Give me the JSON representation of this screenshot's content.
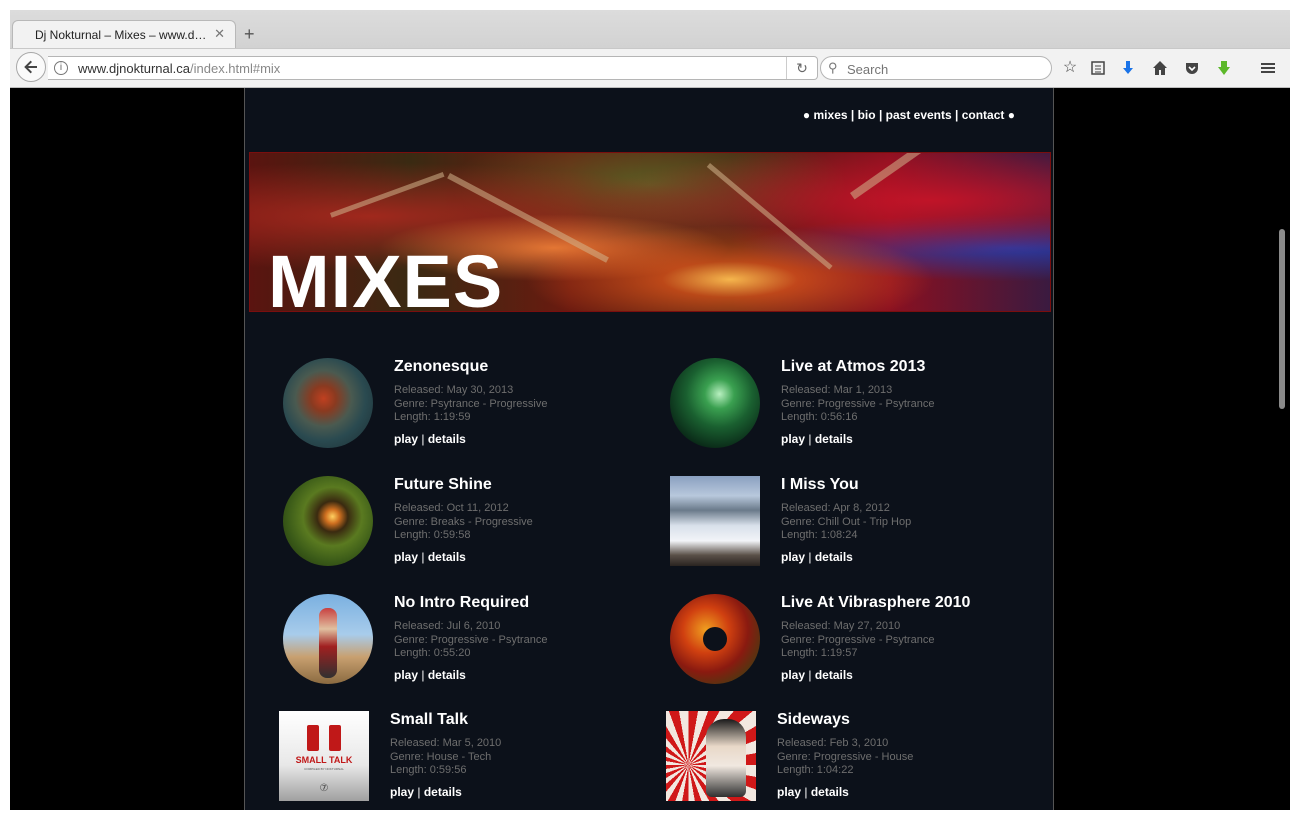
{
  "browser": {
    "tab_title": "Dj Nokturnal – Mixes – www.d…",
    "tab_close": "✕",
    "new_tab": "+",
    "url_domain": "www.djnokturnal.ca",
    "url_path": "/index.html#mix",
    "search_placeholder": "Search"
  },
  "nav": {
    "bullet": "●",
    "items": [
      "mixes",
      "bio",
      "past events",
      "contact"
    ],
    "separator": "|"
  },
  "banner": {
    "title": "MIXES"
  },
  "mix_links": {
    "play": "play",
    "details": "details",
    "separator": "|"
  },
  "mixes": [
    {
      "title": "Zenonesque",
      "released": "Released: May 30, 2013",
      "genre": "Genre: Psytrance - Progressive",
      "length": "Length: 1:19:59"
    },
    {
      "title": "Live at Atmos 2013",
      "released": "Released: Mar 1, 2013",
      "genre": "Genre: Progressive - Psytrance",
      "length": "Length: 0:56:16"
    },
    {
      "title": "Future Shine",
      "released": "Released: Oct 11, 2012",
      "genre": "Genre: Breaks - Progressive",
      "length": "Length: 0:59:58"
    },
    {
      "title": "I Miss You",
      "released": "Released: Apr 8, 2012",
      "genre": "Genre: Chill Out - Trip Hop",
      "length": "Length: 1:08:24"
    },
    {
      "title": "No Intro Required",
      "released": "Released: Jul 6, 2010",
      "genre": "Genre: Progressive - Psytrance",
      "length": "Length: 0:55:20"
    },
    {
      "title": "Live At Vibrasphere 2010",
      "released": "Released: May 27, 2010",
      "genre": "Genre: Progressive - Psytrance",
      "length": "Length: 1:19:57"
    },
    {
      "title": "Small Talk",
      "released": "Released: Mar 5, 2010",
      "genre": "Genre: House - Tech",
      "length": "Length: 0:59:56"
    },
    {
      "title": "Sideways",
      "released": "Released: Feb 3, 2010",
      "genre": "Genre: Progressive - House",
      "length": "Length: 1:04:22"
    }
  ],
  "artwork": {
    "small_talk_text": "SMALL TALK",
    "small_talk_sub": "COMPILED BY NOKTURNAL",
    "small_talk_logo": "⑦"
  }
}
